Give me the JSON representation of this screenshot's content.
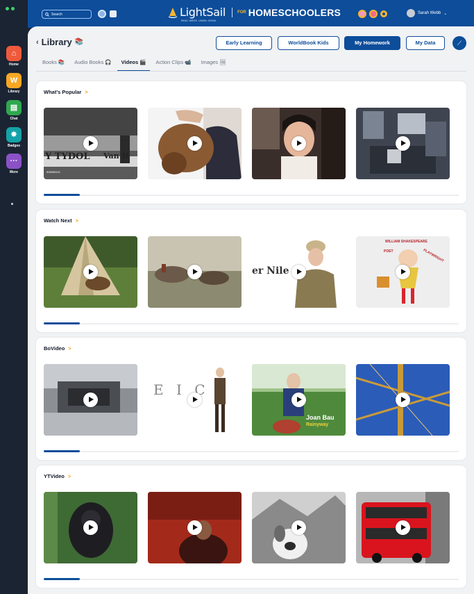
{
  "rail": {
    "items": [
      {
        "label": "Home",
        "icon": "home-icon",
        "color": "#f05a3c",
        "glyph": "⌂"
      },
      {
        "label": "Library",
        "icon": "library-icon",
        "color": "#f7a823",
        "glyph": "W"
      },
      {
        "label": "Chat",
        "icon": "chat-icon",
        "color": "#2fa84f",
        "glyph": "▤"
      },
      {
        "label": "Badges",
        "icon": "badge-icon",
        "color": "#13a3a8",
        "glyph": "✸"
      },
      {
        "label": "More",
        "icon": "more-icon",
        "color": "#8b52c7",
        "glyph": "···"
      }
    ]
  },
  "header": {
    "search_placeholder": "Search",
    "brand": "LightSail",
    "tagline": "READ. WRITE. LEARN. GROW.",
    "for_label": "FOR",
    "home_label": "HOMESCHOOLERS",
    "user_name": "Sarah Webb",
    "user_caret": "⌄"
  },
  "page": {
    "title": "Library",
    "title_emoji": "📚",
    "back": "‹",
    "buttons": {
      "early": "Early Learning",
      "worldbook": "WorldBook Kids",
      "homework": "My Homework",
      "data": "My Data"
    },
    "tabs": [
      {
        "label": "Books",
        "emoji": "📚"
      },
      {
        "label": "Audio Books",
        "emoji": "🎧"
      },
      {
        "label": "Videos",
        "emoji": "🎬"
      },
      {
        "label": "Action Clips",
        "emoji": "📹"
      },
      {
        "label": "Images",
        "emoji": "🖼"
      }
    ]
  },
  "sections": [
    {
      "title": "What's Popular",
      "chev": ">",
      "thumb0_caption": "508059421"
    },
    {
      "title": "Watch Next",
      "chev": ">",
      "thumb2_text": "er Nile"
    },
    {
      "title": "BoVideo",
      "chev": ">",
      "thumb1_text": "E I C",
      "thumb2_text1": "Joan Bau",
      "thumb2_text2": "Rainyway"
    },
    {
      "title": "YTVideo",
      "chev": ">"
    }
  ],
  "thumbs": {
    "s0t0_text": "Y TYDOL",
    "s0t0_text2": "Van H",
    "s1t3_title": "WILLIAM SHAKESPEARE",
    "s1t3_poet": "POET",
    "s1t3_play": "PLAYWRIGHT"
  }
}
